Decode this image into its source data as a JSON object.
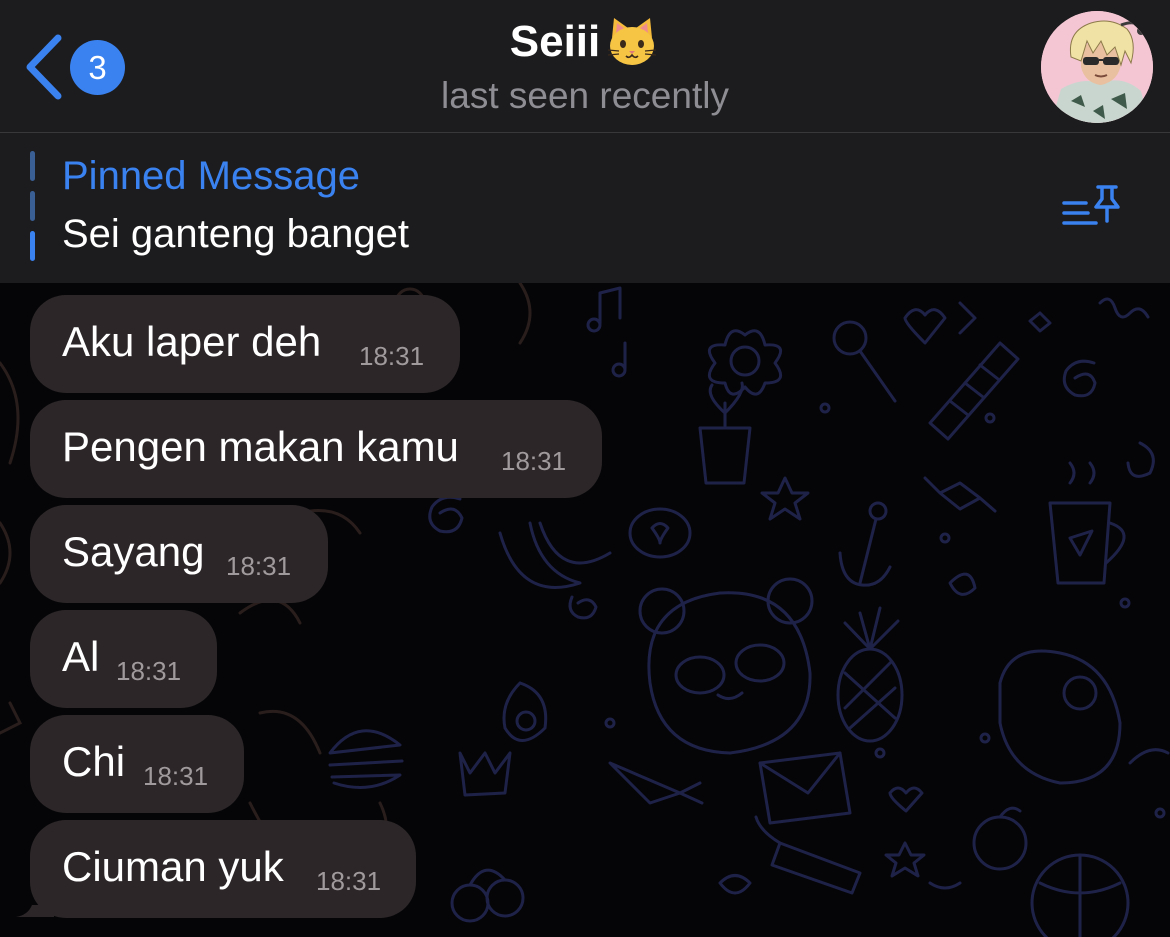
{
  "header": {
    "back_badge": "3",
    "title": "Seiii",
    "title_emoji": "cat-face-icon",
    "status": "last seen recently"
  },
  "pinned": {
    "label": "Pinned Message",
    "text": "Sei ganteng banget"
  },
  "messages": [
    {
      "text": "Aku laper deh",
      "time": "18:31"
    },
    {
      "text": "Pengen makan kamu",
      "time": "18:31"
    },
    {
      "text": "Sayang",
      "time": "18:31"
    },
    {
      "text": "Al",
      "time": "18:31"
    },
    {
      "text": "Chi",
      "time": "18:31"
    },
    {
      "text": "Ciuman yuk",
      "time": "18:31"
    }
  ],
  "colors": {
    "accent": "#3a82f0",
    "header_bg": "#1c1c1e",
    "bubble_bg": "#2c2628",
    "chat_bg": "#050507"
  }
}
